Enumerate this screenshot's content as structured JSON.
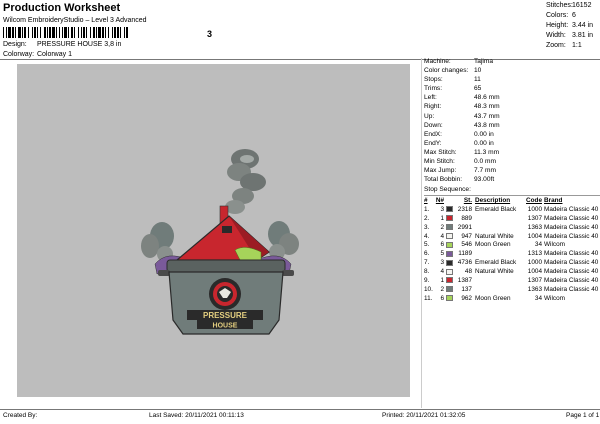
{
  "header": {
    "title": "Production Worksheet",
    "subtitle": "Wilcom EmbroideryStudio – Level 3 Advanced",
    "barcode_mark": "3",
    "design_label": "Design:",
    "design_value": "PRESSURE HOUSE 3,8 in",
    "colorway_label": "Colorway:",
    "colorway_value": "Colorway 1"
  },
  "stats": [
    {
      "key": "Stitches:",
      "value": "16152"
    },
    {
      "key": "Colors:",
      "value": "6"
    },
    {
      "key": "Height:",
      "value": "3.44 in"
    },
    {
      "key": "Width:",
      "value": "3.81 in"
    },
    {
      "key": "Zoom:",
      "value": "1:1"
    }
  ],
  "machine_info": [
    {
      "key": "Machine:",
      "value": "Tajima"
    },
    {
      "key": "Color changes:",
      "value": "10"
    },
    {
      "key": "Stops:",
      "value": "11"
    },
    {
      "key": "Trims:",
      "value": "65"
    },
    {
      "key": "Left:",
      "value": "48.6 mm"
    },
    {
      "key": "Right:",
      "value": "48.3 mm"
    },
    {
      "key": "Up:",
      "value": "43.7 mm"
    },
    {
      "key": "Down:",
      "value": "43.8 mm"
    },
    {
      "key": "EndX:",
      "value": "0.00 in"
    },
    {
      "key": "EndY:",
      "value": "0.00 in"
    },
    {
      "key": "Max Stitch:",
      "value": "11.3 mm"
    },
    {
      "key": "Min Stitch:",
      "value": "0.0 mm"
    },
    {
      "key": "Max Jump:",
      "value": "7.7 mm"
    },
    {
      "key": "Total Bobbin:",
      "value": "93.00ft"
    }
  ],
  "stop_sequence_label": "Stop Sequence:",
  "sequence_headers": {
    "n": "#",
    "num": "N#",
    "st": "St.",
    "desc": "Description",
    "code": "Code",
    "brand": "Brand"
  },
  "sequence": [
    {
      "n": "1.",
      "num": "3",
      "color": "#2a2a2a",
      "st": "2318",
      "desc": "Emerald Black",
      "code": "1000",
      "brand": "Madeira Classic 40"
    },
    {
      "n": "2.",
      "num": "1",
      "color": "#c8262e",
      "st": "889",
      "desc": "",
      "code": "1307",
      "brand": "Madeira Classic 40"
    },
    {
      "n": "3.",
      "num": "2",
      "color": "#707c7a",
      "st": "2991",
      "desc": "",
      "code": "1363",
      "brand": "Madeira Classic 40"
    },
    {
      "n": "4.",
      "num": "4",
      "color": "#f4f4f0",
      "st": "947",
      "desc": "Natural White",
      "code": "1004",
      "brand": "Madeira Classic 40"
    },
    {
      "n": "5.",
      "num": "6",
      "color": "#a6d45a",
      "st": "546",
      "desc": "Moon Green",
      "code": "34",
      "brand": "Wilcom"
    },
    {
      "n": "6.",
      "num": "5",
      "color": "#7a5a9a",
      "st": "1189",
      "desc": "",
      "code": "1313",
      "brand": "Madeira Classic 40"
    },
    {
      "n": "7.",
      "num": "3",
      "color": "#2a2a2a",
      "st": "4736",
      "desc": "Emerald Black",
      "code": "1000",
      "brand": "Madeira Classic 40"
    },
    {
      "n": "8.",
      "num": "4",
      "color": "#f4f4f0",
      "st": "48",
      "desc": "Natural White",
      "code": "1004",
      "brand": "Madeira Classic 40"
    },
    {
      "n": "9.",
      "num": "1",
      "color": "#c8262e",
      "st": "1387",
      "desc": "",
      "code": "1307",
      "brand": "Madeira Classic 40"
    },
    {
      "n": "10.",
      "num": "2",
      "color": "#707c7a",
      "st": "137",
      "desc": "",
      "code": "1363",
      "brand": "Madeira Classic 40"
    },
    {
      "n": "11.",
      "num": "6",
      "color": "#a6d45a",
      "st": "962",
      "desc": "Moon Green",
      "code": "34",
      "brand": "Wilcom"
    }
  ],
  "design_art": {
    "banner_line1": "PRESSURE",
    "banner_line2": "HOUSE"
  },
  "footer": {
    "created_by": "Created By:",
    "last_saved": "Last Saved: 20/11/2021 00:11:13",
    "printed": "Printed: 20/11/2021 01:32:05",
    "page": "Page 1 of 1"
  },
  "colors": {
    "canvas_bg": "#bdbdbd",
    "roof_red": "#c8262e",
    "pot_grey": "#707c7a",
    "slime_green": "#a6d45a",
    "steam_purple": "#7a5a9a"
  }
}
